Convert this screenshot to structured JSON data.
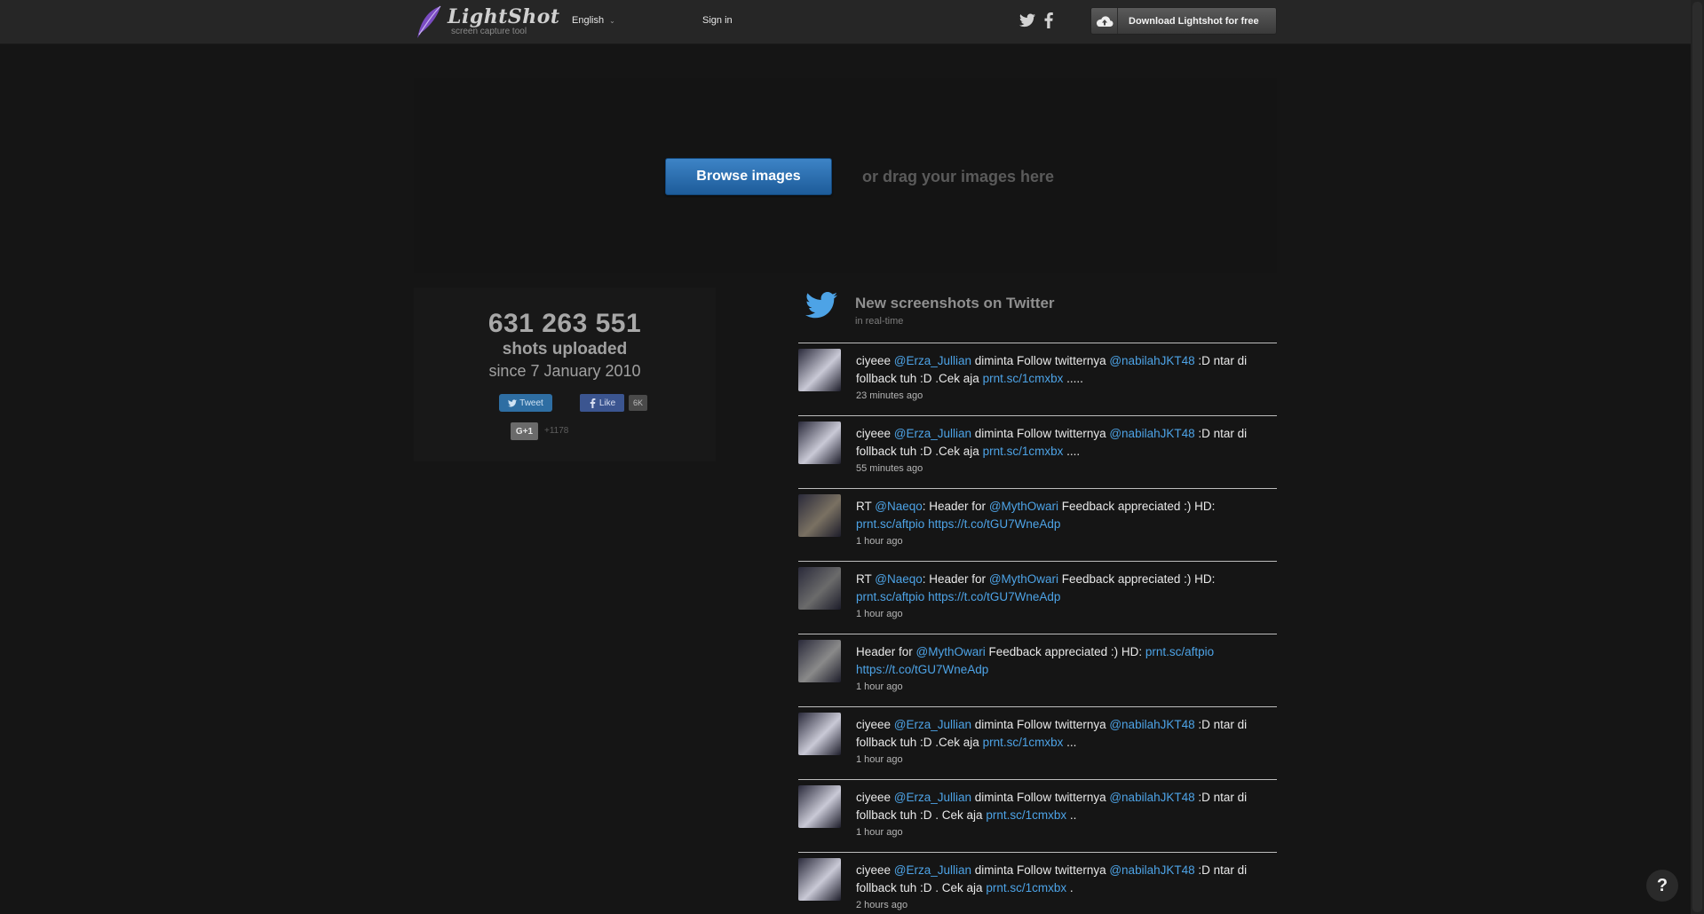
{
  "header": {
    "logo_name": "LightShot",
    "logo_sub": "screen capture tool",
    "language": "English",
    "language_caret": "⌄",
    "sign_in": "Sign in",
    "download_label": "Download Lightshot for free"
  },
  "upload": {
    "browse_label": "Browse images",
    "drag_text": "or drag your images here"
  },
  "stats": {
    "count": "631 263 551",
    "label": "shots uploaded",
    "since": "since 7 January 2010",
    "tweet_label": "Tweet",
    "like_label": "Like",
    "like_count": "6K",
    "gplus_label": "G+1",
    "gplus_count": "+1178"
  },
  "feed": {
    "title": "New screenshots on Twitter",
    "subtitle": "in real-time",
    "tweets": [
      {
        "html": "ciyeee <span class=\"mention\">@Erza_Jullian</span> diminta Follow twitternya <span class=\"mention\">@nabilahJKT48</span> :D ntar di follback tuh :D .Cek aja <span class=\"link\">prnt.sc/1cmxbx</span> .....",
        "time": "23 minutes ago",
        "avatar_color": "#c9c9d6"
      },
      {
        "html": "ciyeee <span class=\"mention\">@Erza_Jullian</span> diminta Follow twitternya <span class=\"mention\">@nabilahJKT48</span> :D ntar di follback tuh :D .Cek aja <span class=\"link\">prnt.sc/1cmxbx</span> ....",
        "time": "55 minutes ago",
        "avatar_color": "#c9c9d6"
      },
      {
        "html": "RT <span class=\"mention\">@Naeqo</span>: Header for <span class=\"mention\">@MythOwari</span> Feedback appreciated :) HD: <span class=\"link\">prnt.sc/aftpio</span> <span class=\"link\">https://t.co/tGU7WneAdp</span>",
        "time": "1 hour ago",
        "avatar_color": "#7a7162"
      },
      {
        "html": "RT <span class=\"mention\">@Naeqo</span>: Header for <span class=\"mention\">@MythOwari</span> Feedback appreciated :) HD: <span class=\"link\">prnt.sc/aftpio</span> <span class=\"link\">https://t.co/tGU7WneAdp</span>",
        "time": "1 hour ago",
        "avatar_color": "#6b6b6b"
      },
      {
        "html": "Header for <span class=\"mention\">@MythOwari</span> Feedback appreciated :) HD: <span class=\"link\">prnt.sc/aftpio</span> <span class=\"link\">https://t.co/tGU7WneAdp</span>",
        "time": "1 hour ago",
        "avatar_color": "#8a8a8a"
      },
      {
        "html": "ciyeee <span class=\"mention\">@Erza_Jullian</span> diminta Follow twitternya <span class=\"mention\">@nabilahJKT48</span> :D ntar di follback tuh :D .Cek aja <span class=\"link\">prnt.sc/1cmxbx</span> ...",
        "time": "1 hour ago",
        "avatar_color": "#c9c9d6"
      },
      {
        "html": "ciyeee <span class=\"mention\">@Erza_Jullian</span> diminta Follow twitternya <span class=\"mention\">@nabilahJKT48</span> :D ntar di follback tuh :D . Cek aja <span class=\"link\">prnt.sc/1cmxbx</span> ..",
        "time": "1 hour ago",
        "avatar_color": "#c9c9d6"
      },
      {
        "html": "ciyeee <span class=\"mention\">@Erza_Jullian</span> diminta Follow twitternya <span class=\"mention\">@nabilahJKT48</span> :D ntar di follback tuh :D . Cek aja <span class=\"link\">prnt.sc/1cmxbx</span> .",
        "time": "2 hours ago",
        "avatar_color": "#c9c9d6"
      }
    ]
  },
  "help_label": "?",
  "colors": {
    "background": "#151515",
    "header_bg": "#262626",
    "accent_blue": "#2a6fb0",
    "link_blue": "#4da3e6"
  },
  "icons": [
    "feather-logo-icon",
    "chevron-down-icon",
    "twitter-icon",
    "facebook-icon",
    "cloud-upload-icon",
    "twitter-bird-icon"
  ]
}
